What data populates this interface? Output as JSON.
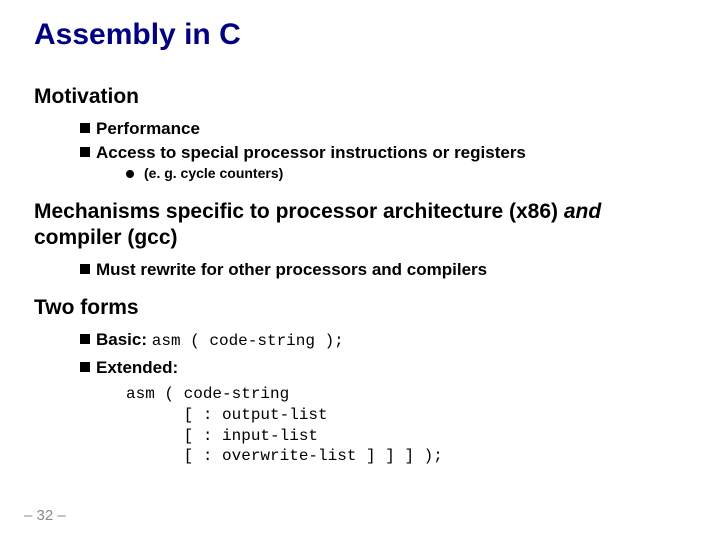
{
  "title": "Assembly in C",
  "sections": {
    "motivation": {
      "heading": "Motivation",
      "items": [
        {
          "text": "Performance"
        },
        {
          "text": "Access to special processor instructions or registers",
          "sub": "(e. g. cycle counters)"
        }
      ]
    },
    "mechanisms": {
      "heading_prefix": "Mechanisms specific to processor architecture (x86) ",
      "heading_italic": "and",
      "heading_suffix": " compiler (gcc)",
      "items": [
        {
          "text": "Must rewrite for other processors and compilers"
        }
      ]
    },
    "twoforms": {
      "heading": "Two forms",
      "basic_label": "Basic: ",
      "basic_code": "asm ( code-string );",
      "extended_label": "Extended:",
      "extended_code": "asm ( code-string\n      [ : output-list\n      [ : input-list\n      [ : overwrite-list ] ] ] );"
    }
  },
  "footer": "– 32 –"
}
